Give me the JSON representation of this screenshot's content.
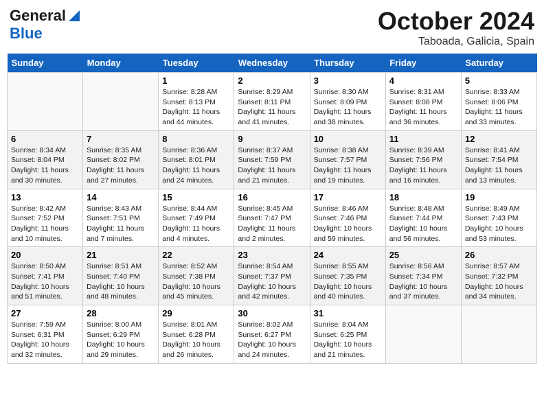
{
  "header": {
    "logo_general": "General",
    "logo_blue": "Blue",
    "month": "October 2024",
    "location": "Taboada, Galicia, Spain"
  },
  "days_of_week": [
    "Sunday",
    "Monday",
    "Tuesday",
    "Wednesday",
    "Thursday",
    "Friday",
    "Saturday"
  ],
  "weeks": [
    [
      {
        "day": "",
        "sunrise": "",
        "sunset": "",
        "daylight": ""
      },
      {
        "day": "",
        "sunrise": "",
        "sunset": "",
        "daylight": ""
      },
      {
        "day": "1",
        "sunrise": "Sunrise: 8:28 AM",
        "sunset": "Sunset: 8:13 PM",
        "daylight": "Daylight: 11 hours and 44 minutes."
      },
      {
        "day": "2",
        "sunrise": "Sunrise: 8:29 AM",
        "sunset": "Sunset: 8:11 PM",
        "daylight": "Daylight: 11 hours and 41 minutes."
      },
      {
        "day": "3",
        "sunrise": "Sunrise: 8:30 AM",
        "sunset": "Sunset: 8:09 PM",
        "daylight": "Daylight: 11 hours and 38 minutes."
      },
      {
        "day": "4",
        "sunrise": "Sunrise: 8:31 AM",
        "sunset": "Sunset: 8:08 PM",
        "daylight": "Daylight: 11 hours and 36 minutes."
      },
      {
        "day": "5",
        "sunrise": "Sunrise: 8:33 AM",
        "sunset": "Sunset: 8:06 PM",
        "daylight": "Daylight: 11 hours and 33 minutes."
      }
    ],
    [
      {
        "day": "6",
        "sunrise": "Sunrise: 8:34 AM",
        "sunset": "Sunset: 8:04 PM",
        "daylight": "Daylight: 11 hours and 30 minutes."
      },
      {
        "day": "7",
        "sunrise": "Sunrise: 8:35 AM",
        "sunset": "Sunset: 8:02 PM",
        "daylight": "Daylight: 11 hours and 27 minutes."
      },
      {
        "day": "8",
        "sunrise": "Sunrise: 8:36 AM",
        "sunset": "Sunset: 8:01 PM",
        "daylight": "Daylight: 11 hours and 24 minutes."
      },
      {
        "day": "9",
        "sunrise": "Sunrise: 8:37 AM",
        "sunset": "Sunset: 7:59 PM",
        "daylight": "Daylight: 11 hours and 21 minutes."
      },
      {
        "day": "10",
        "sunrise": "Sunrise: 8:38 AM",
        "sunset": "Sunset: 7:57 PM",
        "daylight": "Daylight: 11 hours and 19 minutes."
      },
      {
        "day": "11",
        "sunrise": "Sunrise: 8:39 AM",
        "sunset": "Sunset: 7:56 PM",
        "daylight": "Daylight: 11 hours and 16 minutes."
      },
      {
        "day": "12",
        "sunrise": "Sunrise: 8:41 AM",
        "sunset": "Sunset: 7:54 PM",
        "daylight": "Daylight: 11 hours and 13 minutes."
      }
    ],
    [
      {
        "day": "13",
        "sunrise": "Sunrise: 8:42 AM",
        "sunset": "Sunset: 7:52 PM",
        "daylight": "Daylight: 11 hours and 10 minutes."
      },
      {
        "day": "14",
        "sunrise": "Sunrise: 8:43 AM",
        "sunset": "Sunset: 7:51 PM",
        "daylight": "Daylight: 11 hours and 7 minutes."
      },
      {
        "day": "15",
        "sunrise": "Sunrise: 8:44 AM",
        "sunset": "Sunset: 7:49 PM",
        "daylight": "Daylight: 11 hours and 4 minutes."
      },
      {
        "day": "16",
        "sunrise": "Sunrise: 8:45 AM",
        "sunset": "Sunset: 7:47 PM",
        "daylight": "Daylight: 11 hours and 2 minutes."
      },
      {
        "day": "17",
        "sunrise": "Sunrise: 8:46 AM",
        "sunset": "Sunset: 7:46 PM",
        "daylight": "Daylight: 10 hours and 59 minutes."
      },
      {
        "day": "18",
        "sunrise": "Sunrise: 8:48 AM",
        "sunset": "Sunset: 7:44 PM",
        "daylight": "Daylight: 10 hours and 56 minutes."
      },
      {
        "day": "19",
        "sunrise": "Sunrise: 8:49 AM",
        "sunset": "Sunset: 7:43 PM",
        "daylight": "Daylight: 10 hours and 53 minutes."
      }
    ],
    [
      {
        "day": "20",
        "sunrise": "Sunrise: 8:50 AM",
        "sunset": "Sunset: 7:41 PM",
        "daylight": "Daylight: 10 hours and 51 minutes."
      },
      {
        "day": "21",
        "sunrise": "Sunrise: 8:51 AM",
        "sunset": "Sunset: 7:40 PM",
        "daylight": "Daylight: 10 hours and 48 minutes."
      },
      {
        "day": "22",
        "sunrise": "Sunrise: 8:52 AM",
        "sunset": "Sunset: 7:38 PM",
        "daylight": "Daylight: 10 hours and 45 minutes."
      },
      {
        "day": "23",
        "sunrise": "Sunrise: 8:54 AM",
        "sunset": "Sunset: 7:37 PM",
        "daylight": "Daylight: 10 hours and 42 minutes."
      },
      {
        "day": "24",
        "sunrise": "Sunrise: 8:55 AM",
        "sunset": "Sunset: 7:35 PM",
        "daylight": "Daylight: 10 hours and 40 minutes."
      },
      {
        "day": "25",
        "sunrise": "Sunrise: 8:56 AM",
        "sunset": "Sunset: 7:34 PM",
        "daylight": "Daylight: 10 hours and 37 minutes."
      },
      {
        "day": "26",
        "sunrise": "Sunrise: 8:57 AM",
        "sunset": "Sunset: 7:32 PM",
        "daylight": "Daylight: 10 hours and 34 minutes."
      }
    ],
    [
      {
        "day": "27",
        "sunrise": "Sunrise: 7:59 AM",
        "sunset": "Sunset: 6:31 PM",
        "daylight": "Daylight: 10 hours and 32 minutes."
      },
      {
        "day": "28",
        "sunrise": "Sunrise: 8:00 AM",
        "sunset": "Sunset: 6:29 PM",
        "daylight": "Daylight: 10 hours and 29 minutes."
      },
      {
        "day": "29",
        "sunrise": "Sunrise: 8:01 AM",
        "sunset": "Sunset: 6:28 PM",
        "daylight": "Daylight: 10 hours and 26 minutes."
      },
      {
        "day": "30",
        "sunrise": "Sunrise: 8:02 AM",
        "sunset": "Sunset: 6:27 PM",
        "daylight": "Daylight: 10 hours and 24 minutes."
      },
      {
        "day": "31",
        "sunrise": "Sunrise: 8:04 AM",
        "sunset": "Sunset: 6:25 PM",
        "daylight": "Daylight: 10 hours and 21 minutes."
      },
      {
        "day": "",
        "sunrise": "",
        "sunset": "",
        "daylight": ""
      },
      {
        "day": "",
        "sunrise": "",
        "sunset": "",
        "daylight": ""
      }
    ]
  ]
}
